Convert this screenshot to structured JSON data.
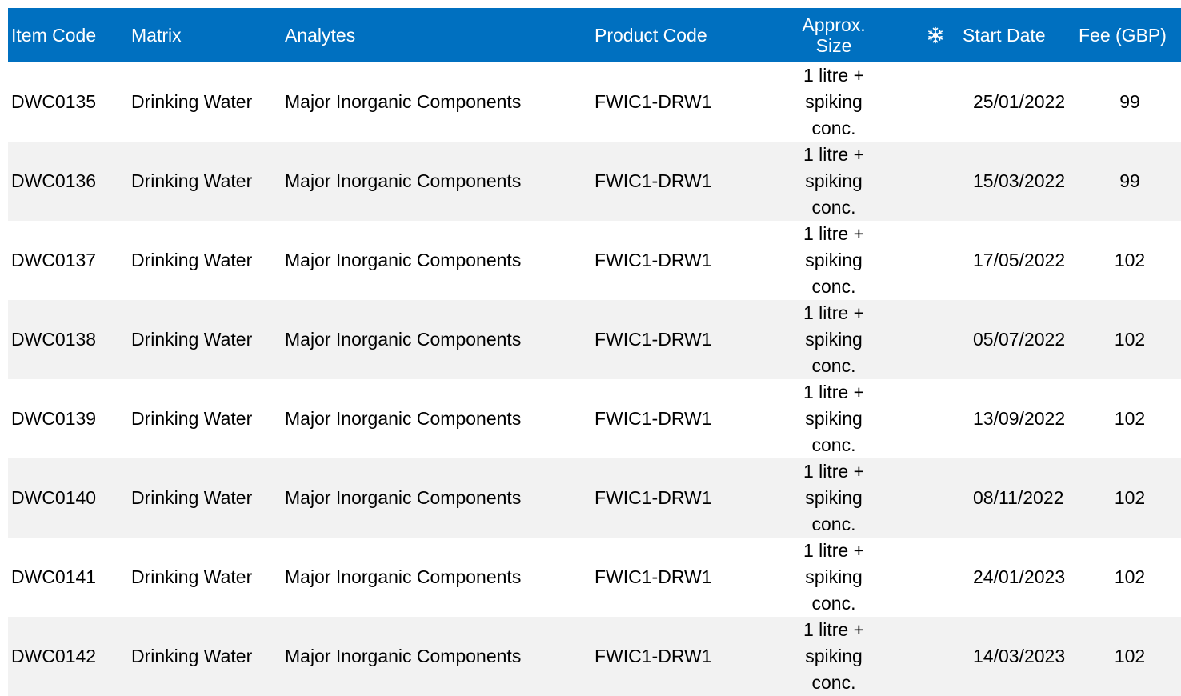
{
  "table": {
    "headers": {
      "item_code": "Item Code",
      "matrix": "Matrix",
      "analytes": "Analytes",
      "product_code": "Product Code",
      "approx_size": "Approx.\nSize",
      "snowflake_icon": "snowflake-icon",
      "start_date": "Start Date",
      "fee": "Fee (GBP)"
    },
    "colors": {
      "header_bg": "#0070c0",
      "header_text": "#ffffff",
      "row_shade": "#f2f2f2"
    },
    "rows": [
      {
        "item_code": "DWC0135",
        "matrix": "Drinking Water",
        "analytes": "Major Inorganic Components",
        "product_code": "FWIC1-DRW1",
        "size": "1 litre +\nspiking\nconc.",
        "start_date": "25/01/2022",
        "fee": "99"
      },
      {
        "item_code": "DWC0136",
        "matrix": "Drinking Water",
        "analytes": "Major Inorganic Components",
        "product_code": "FWIC1-DRW1",
        "size": "1 litre +\nspiking\nconc.",
        "start_date": "15/03/2022",
        "fee": "99"
      },
      {
        "item_code": "DWC0137",
        "matrix": "Drinking Water",
        "analytes": "Major Inorganic Components",
        "product_code": "FWIC1-DRW1",
        "size": "1 litre +\nspiking\nconc.",
        "start_date": "17/05/2022",
        "fee": "102"
      },
      {
        "item_code": "DWC0138",
        "matrix": "Drinking Water",
        "analytes": "Major Inorganic Components",
        "product_code": "FWIC1-DRW1",
        "size": "1 litre +\nspiking\nconc.",
        "start_date": "05/07/2022",
        "fee": "102"
      },
      {
        "item_code": "DWC0139",
        "matrix": "Drinking Water",
        "analytes": "Major Inorganic Components",
        "product_code": "FWIC1-DRW1",
        "size": "1 litre +\nspiking\nconc.",
        "start_date": "13/09/2022",
        "fee": "102"
      },
      {
        "item_code": "DWC0140",
        "matrix": "Drinking Water",
        "analytes": "Major Inorganic Components",
        "product_code": "FWIC1-DRW1",
        "size": "1 litre +\nspiking\nconc.",
        "start_date": "08/11/2022",
        "fee": "102"
      },
      {
        "item_code": "DWC0141",
        "matrix": "Drinking Water",
        "analytes": "Major Inorganic Components",
        "product_code": "FWIC1-DRW1",
        "size": "1 litre +\nspiking\nconc.",
        "start_date": "24/01/2023",
        "fee": "102"
      },
      {
        "item_code": "DWC0142",
        "matrix": "Drinking Water",
        "analytes": "Major Inorganic Components",
        "product_code": "FWIC1-DRW1",
        "size": "1 litre +\nspiking\nconc.",
        "start_date": "14/03/2023",
        "fee": "102"
      }
    ]
  }
}
